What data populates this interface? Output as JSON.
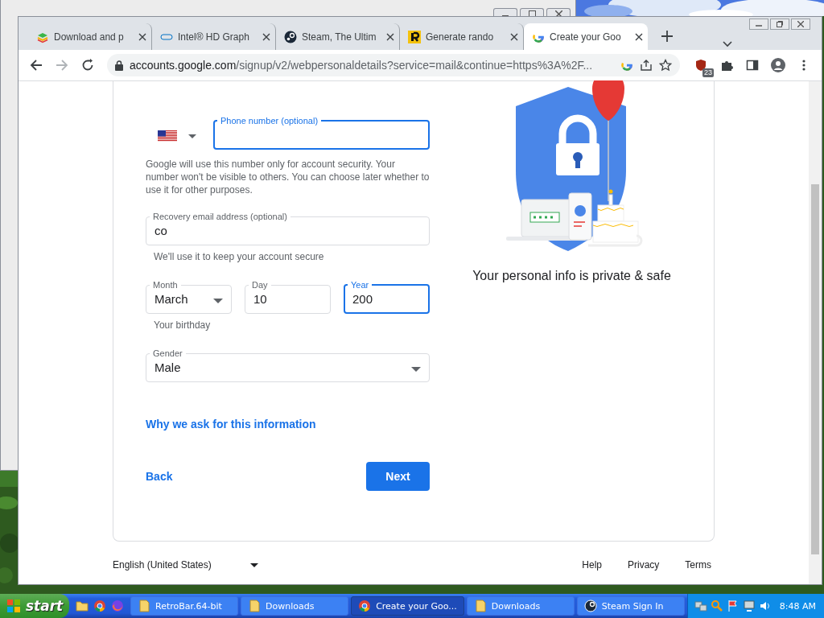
{
  "browser": {
    "tabs": [
      {
        "title": "Download and p",
        "selected": false
      },
      {
        "title": "Intel® HD Graph",
        "selected": false
      },
      {
        "title": "Steam, The Ultim",
        "selected": false
      },
      {
        "title": "Generate rando",
        "selected": false
      },
      {
        "title": "Create your Goo",
        "selected": true
      }
    ],
    "address": {
      "domain": "accounts.google.com",
      "path": "/signup/v2/webpersonaldetails?service=mail&continue=https%3A%2F..."
    },
    "extension_badge": "23"
  },
  "form": {
    "phone": {
      "label": "Phone number (optional)",
      "focused": true
    },
    "phone_hint": "Google will use this number only for account security. Your number won't be visible to others. You can choose later whether to use it for other purposes.",
    "recovery": {
      "label": "Recovery email address (optional)",
      "value": "co",
      "focused": false
    },
    "recovery_hint": "We'll use it to keep your account secure",
    "birthday": [
      {
        "kind": "select",
        "label": "Month",
        "value": "March",
        "focused": false
      },
      {
        "kind": "text",
        "label": "Day",
        "value": "10",
        "focused": false
      },
      {
        "kind": "text",
        "label": "Year",
        "value": "200",
        "focused": true
      }
    ],
    "birthday_hint": "Your birthday",
    "gender": {
      "kind": "select",
      "label": "Gender",
      "value": "Male",
      "focused": false
    },
    "why_link": "Why we ask for this information",
    "back": "Back",
    "next": "Next"
  },
  "illustration_caption": "Your personal info is private & safe",
  "footer": {
    "language": "English (United States)",
    "links": [
      "Help",
      "Privacy",
      "Terms"
    ]
  },
  "taskbar": {
    "start": "start",
    "buttons": [
      {
        "label": "RetroBar.64-bit",
        "selected": false
      },
      {
        "label": "Downloads",
        "selected": false
      },
      {
        "label": "Create your Goo...",
        "selected": true
      },
      {
        "label": "Downloads",
        "selected": false
      },
      {
        "label": "Steam Sign In",
        "selected": false
      }
    ],
    "clock": "8:48 AM"
  }
}
